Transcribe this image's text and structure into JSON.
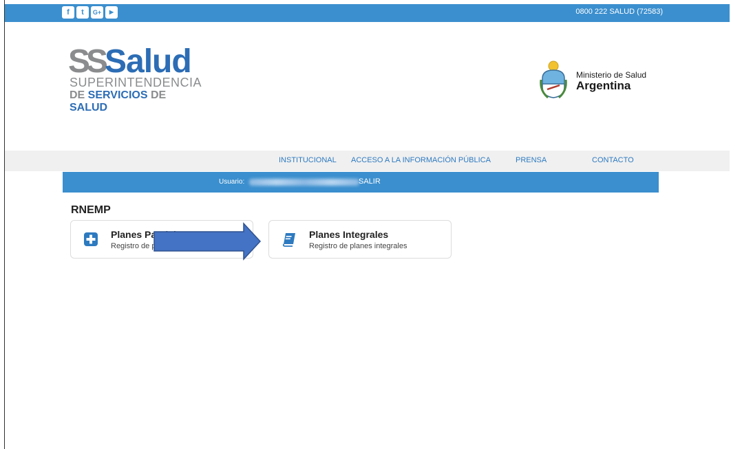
{
  "topbar": {
    "social_icons": [
      "facebook-icon",
      "twitter-icon",
      "google-plus-icon",
      "youtube-icon"
    ],
    "phone": "0800 222 SALUD (72583)"
  },
  "logo": {
    "ss": "SS",
    "salud": "Salud",
    "line1": "SUPERINTENDENCIA",
    "line2_a": "DE ",
    "line2_b": "SERVICIOS",
    "line2_c": " DE ",
    "line2_d": "SALUD"
  },
  "ministerio": {
    "line1": "Ministerio de Salud",
    "line2": "Argentina"
  },
  "nav": {
    "items": [
      "INSTITUCIONAL",
      "ACCESO A LA INFORMACIÓN PÚBLICA",
      "PRENSA",
      "CONTACTO"
    ]
  },
  "userbar": {
    "label": "Usuario:",
    "salir": "SALIR"
  },
  "section": {
    "title": "RNEMP"
  },
  "cards": [
    {
      "title": "Planes Parciales",
      "subtitle": "Registro de planes parciales",
      "icon": "plus-square-icon"
    },
    {
      "title": "Planes Integrales",
      "subtitle": "Registro de planes integrales",
      "icon": "book-icon"
    }
  ],
  "colors": {
    "primary": "#3b8fce",
    "nav_link": "#2d7ac0",
    "arrow": "#4472c4"
  }
}
